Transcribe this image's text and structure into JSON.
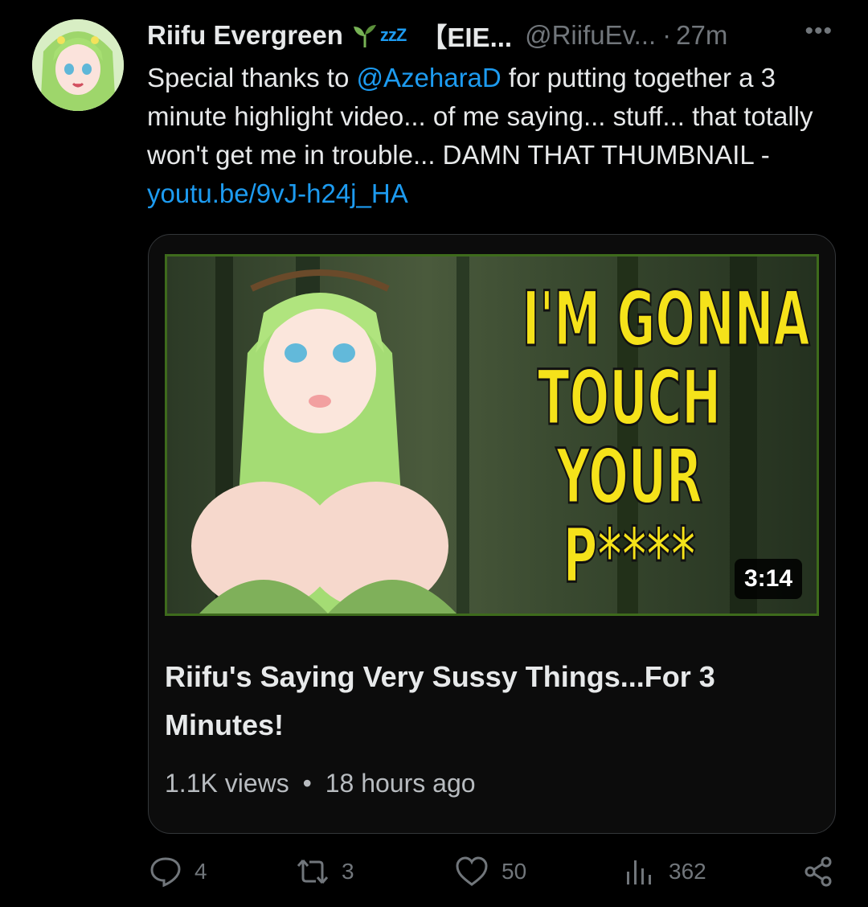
{
  "author": {
    "name": "Riifu Evergreen",
    "zzz": "zzZ",
    "bracket_name": "【EIE...",
    "handle": "@RiifuEv...",
    "time": "27m"
  },
  "tweet": {
    "text_before_mention": "Special thanks to ",
    "mention": "@AzeharaD",
    "text_after_mention": " for putting together a 3 minute highlight video... of me saying... stuff... that totally won't get me in trouble... DAMN THAT THUMBNAIL - ",
    "link": "youtu.be/9vJ-h24j_HA"
  },
  "card": {
    "thumbnail_text": "I'M GONNA\nTOUCH\nYOUR\nP****",
    "duration": "3:14",
    "title": "Riifu's Saying Very Sussy Things...For 3 Minutes!",
    "views": "1.1K views",
    "separator": "•",
    "age": "18 hours ago"
  },
  "actions": {
    "replies": "4",
    "retweets": "3",
    "likes": "50",
    "views": "362"
  },
  "icons": [
    "more-icon",
    "reply-icon",
    "retweet-icon",
    "like-icon",
    "views-icon",
    "share-icon"
  ],
  "colors": {
    "accent": "#1d9bf0",
    "text": "#e7e9ea",
    "muted": "#71767b",
    "background": "#000000"
  }
}
